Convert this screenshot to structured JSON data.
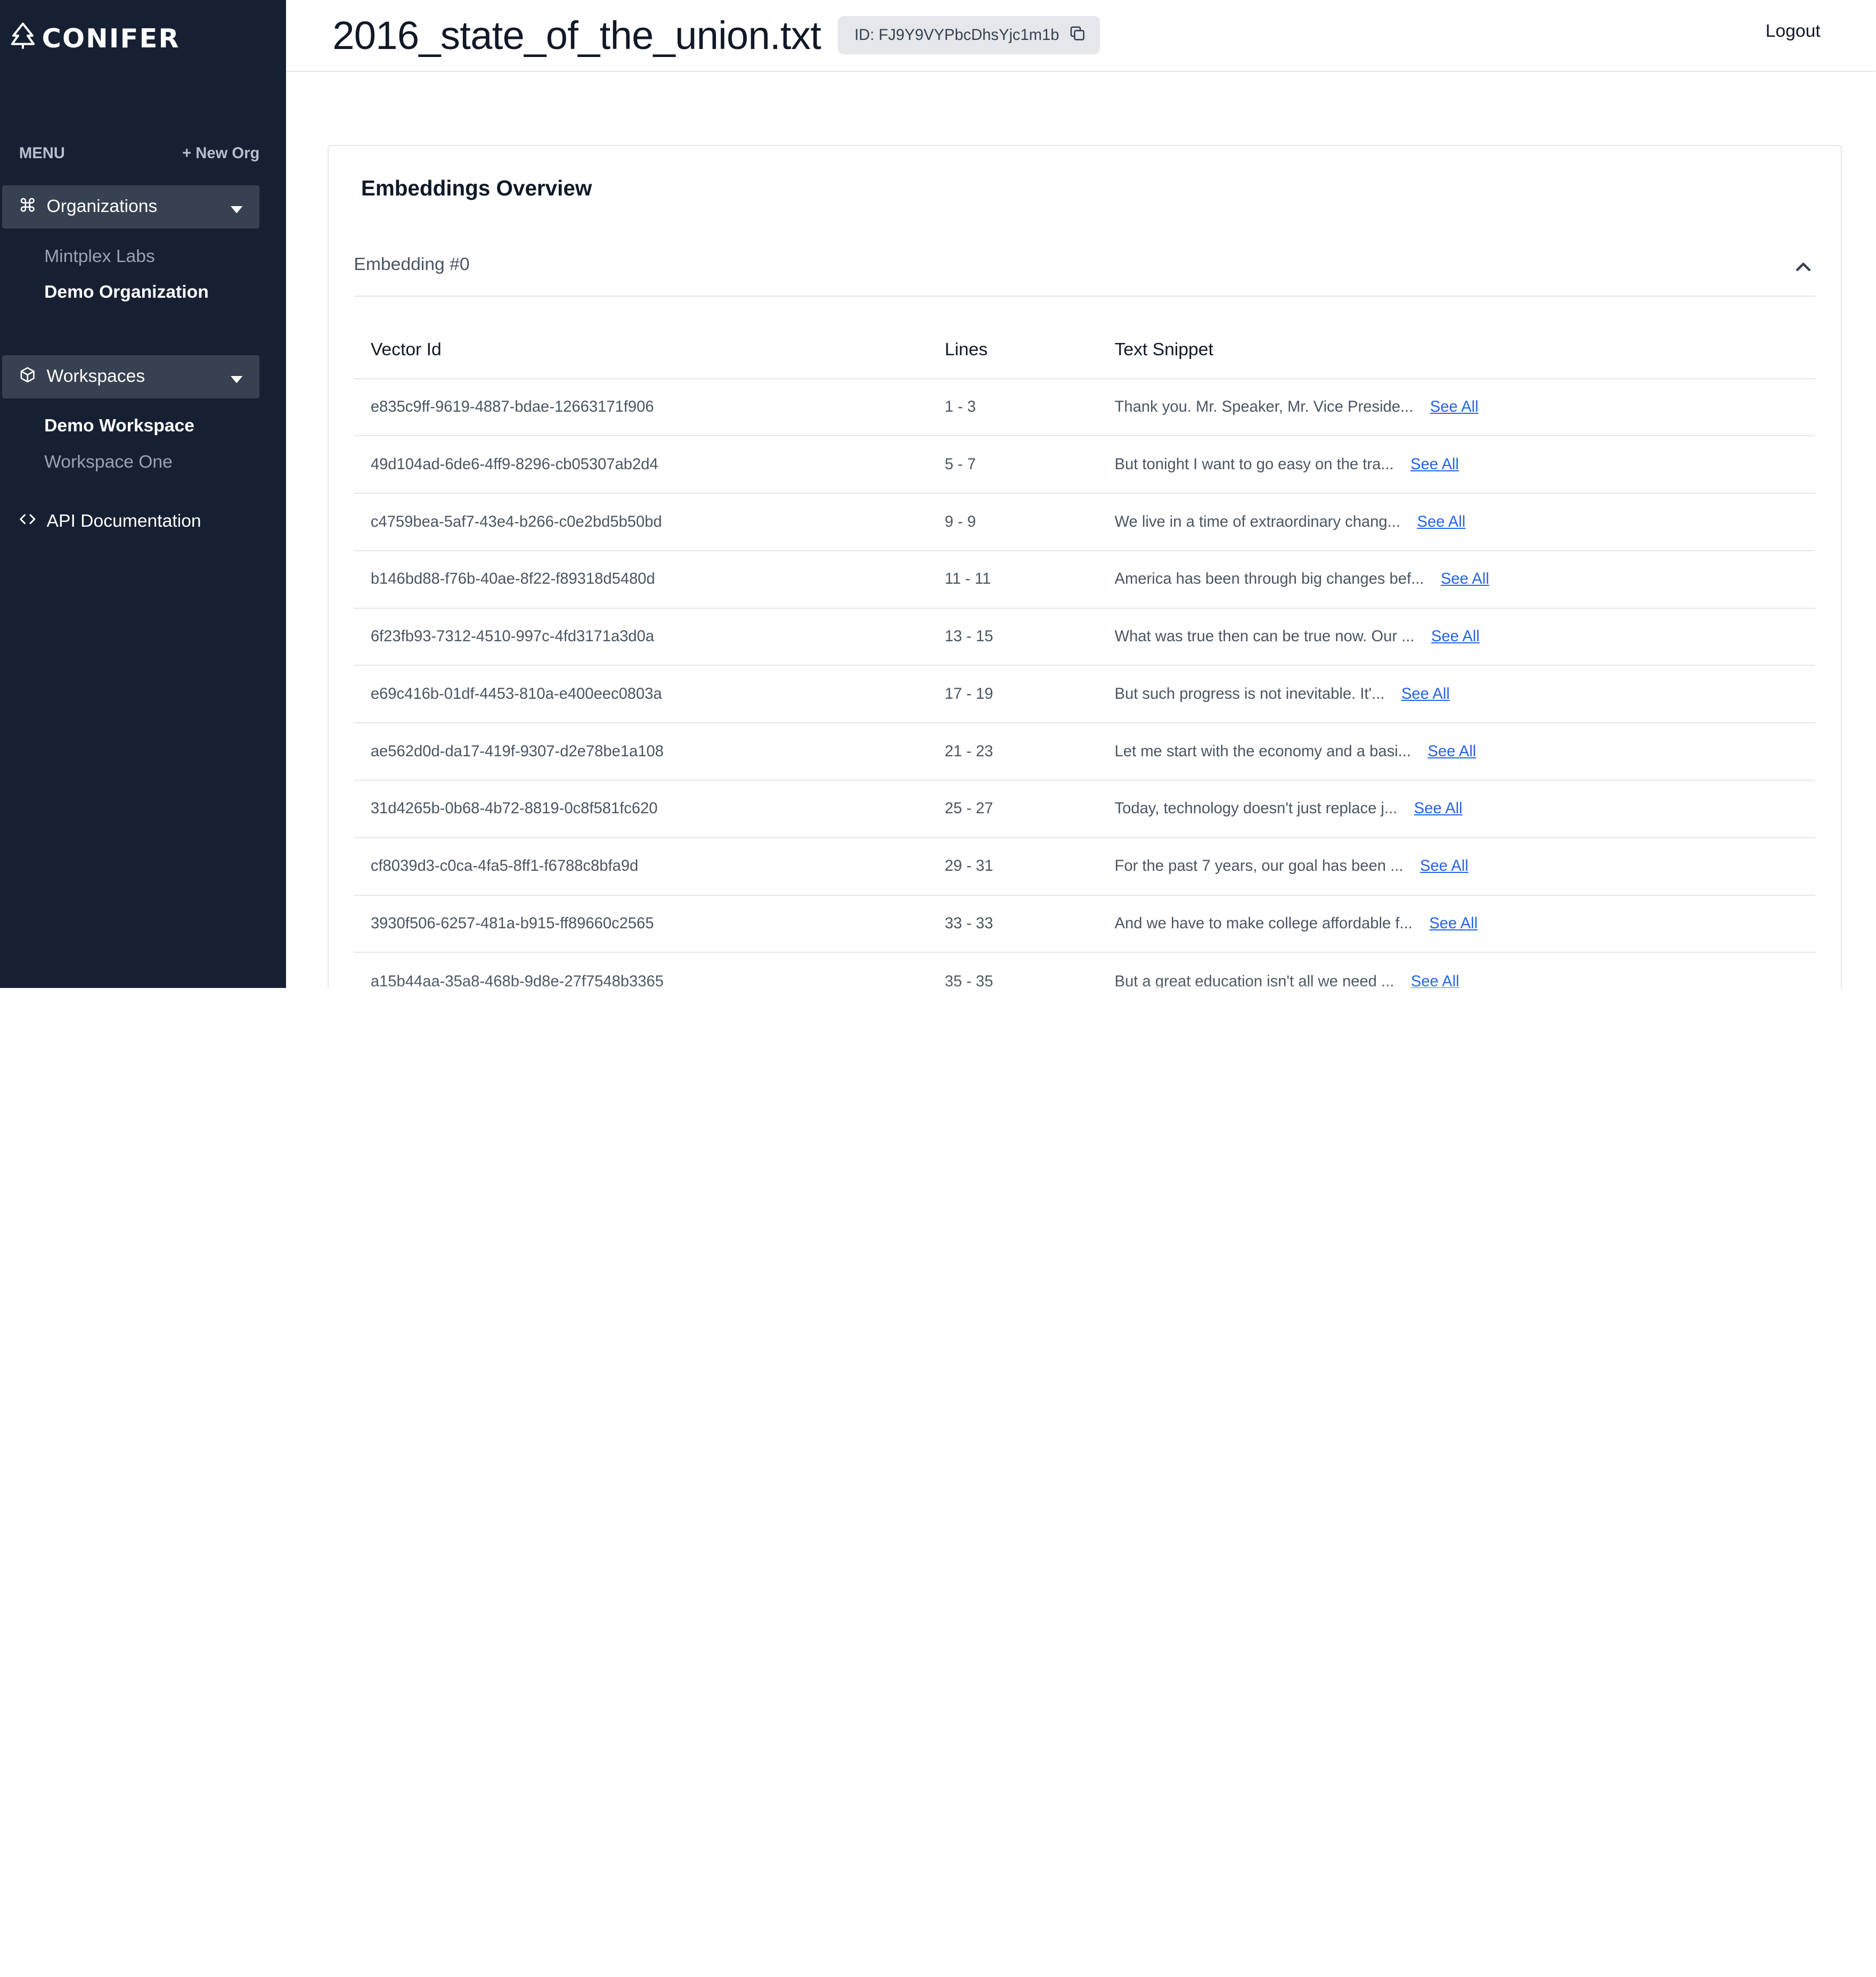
{
  "sidebar": {
    "logo_text": "CONIFER",
    "menu_label": "MENU",
    "new_org_label": "+ New Org",
    "organizations": {
      "label": "Organizations",
      "items": [
        "Mintplex Labs",
        "Demo Organization"
      ]
    },
    "workspaces": {
      "label": "Workspaces",
      "items": [
        "Demo Workspace",
        "Workspace One"
      ]
    },
    "api_doc_label": "API Documentation"
  },
  "header": {
    "title": "2016_state_of_the_union.txt",
    "id_badge": "ID: FJ9Y9VYPbcDhsYjc1m1b",
    "logout_label": "Logout"
  },
  "card": {
    "title": "Embeddings Overview",
    "accordion_label": "Embedding #0",
    "columns": [
      "Vector Id",
      "Lines",
      "Text Snippet"
    ],
    "see_all_label": "See All",
    "rows": [
      {
        "id": "e835c9ff-9619-4887-bdae-12663171f906",
        "lines": "1 - 3",
        "snippet": "Thank you. Mr. Speaker, Mr. Vice Preside..."
      },
      {
        "id": "49d104ad-6de6-4ff9-8296-cb05307ab2d4",
        "lines": "5 - 7",
        "snippet": "But tonight I want to go easy on the tra..."
      },
      {
        "id": "c4759bea-5af7-43e4-b266-c0e2bd5b50bd",
        "lines": "9 - 9",
        "snippet": "We live in a time of extraordinary chang..."
      },
      {
        "id": "b146bd88-f76b-40ae-8f22-f89318d5480d",
        "lines": "11 - 11",
        "snippet": "America has been through big changes bef..."
      },
      {
        "id": "6f23fb93-7312-4510-997c-4fd3171a3d0a",
        "lines": "13 - 15",
        "snippet": "What was true then can be true now. Our ..."
      },
      {
        "id": "e69c416b-01df-4453-810a-e400eec0803a",
        "lines": "17 - 19",
        "snippet": "But such progress is not inevitable. It'..."
      },
      {
        "id": "ae562d0d-da17-419f-9307-d2e78be1a108",
        "lines": "21 - 23",
        "snippet": "Let me start with the economy and a basi..."
      },
      {
        "id": "31d4265b-0b68-4b72-8819-0c8f581fc620",
        "lines": "25 - 27",
        "snippet": "Today, technology doesn't just replace j..."
      },
      {
        "id": "cf8039d3-c0ca-4fa5-8ff1-f6788c8bfa9d",
        "lines": "29 - 31",
        "snippet": "For the past 7 years, our goal has been ..."
      },
      {
        "id": "3930f506-6257-481a-b915-ff89660c2565",
        "lines": "33 - 33",
        "snippet": "And we have to make college affordable f..."
      },
      {
        "id": "a15b44aa-35a8-468b-9d8e-27f7548b3365",
        "lines": "35 - 35",
        "snippet": "But a great education isn't all we need ..."
      }
    ]
  },
  "icons": {
    "logo": "tree-icon",
    "organizations": "command-icon",
    "workspaces": "cube-icon",
    "api": "code-icon",
    "copy": "copy-icon",
    "dropdown": "caret-down-icon",
    "collapse": "chevron-up-icon"
  },
  "colors": {
    "sidebar_bg": "#172033",
    "section_bg": "#374151",
    "link": "#2563eb"
  }
}
